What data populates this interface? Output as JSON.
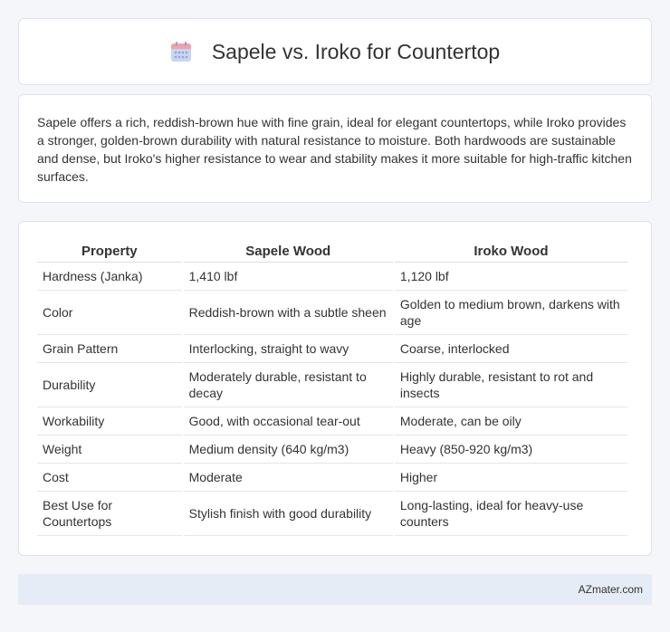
{
  "header": {
    "title": "Sapele vs. Iroko for Countertop",
    "icon": "calendar-icon",
    "icon_colors": {
      "top": "#f3a0a8",
      "body": "#c9d6f2",
      "dots": "#8fa5d8"
    }
  },
  "summary": {
    "text": "Sapele offers a rich, reddish-brown hue with fine grain, ideal for elegant countertops, while Iroko provides a stronger, golden-brown durability with natural resistance to moisture. Both hardwoods are sustainable and dense, but Iroko's higher resistance to wear and stability makes it more suitable for high-traffic kitchen surfaces."
  },
  "table": {
    "headers": [
      "Property",
      "Sapele Wood",
      "Iroko Wood"
    ],
    "rows": [
      [
        "Hardness (Janka)",
        "1,410 lbf",
        "1,120 lbf"
      ],
      [
        "Color",
        "Reddish-brown with a subtle sheen",
        "Golden to medium brown, darkens with age"
      ],
      [
        "Grain Pattern",
        "Interlocking, straight to wavy",
        "Coarse, interlocked"
      ],
      [
        "Durability",
        "Moderately durable, resistant to decay",
        "Highly durable, resistant to rot and insects"
      ],
      [
        "Workability",
        "Good, with occasional tear-out",
        "Moderate, can be oily"
      ],
      [
        "Weight",
        "Medium density (640 kg/m3)",
        "Heavy (850-920 kg/m3)"
      ],
      [
        "Cost",
        "Moderate",
        "Higher"
      ],
      [
        "Best Use for Countertops",
        "Stylish finish with good durability",
        "Long-lasting, ideal for heavy-use counters"
      ]
    ]
  },
  "footer": {
    "brand": "AZmater.com"
  }
}
